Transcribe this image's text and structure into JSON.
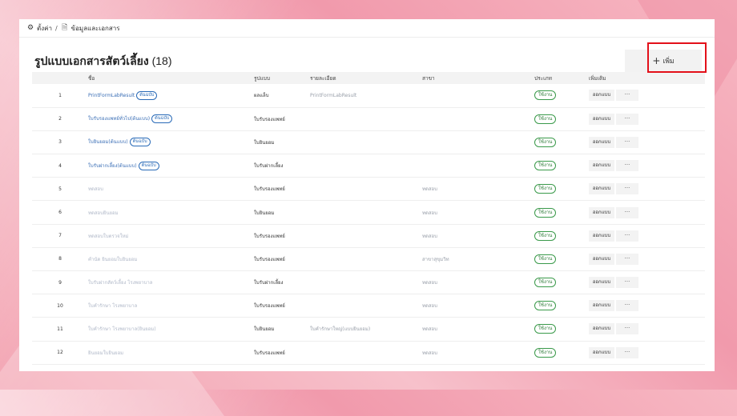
{
  "breadcrumb": {
    "settings": "ตั้งค่า",
    "separator": "/",
    "current": "ข้อมูลและเอกสาร"
  },
  "page": {
    "title": "รูปแบบเอกสารสัตว์เลี้ยง",
    "count": "(18)"
  },
  "toolbar": {
    "add_label": "เพิ่ม"
  },
  "table": {
    "headers": {
      "name": "ชื่อ",
      "format": "รูปแบบ",
      "detail": "รายละเอียด",
      "branch": "สาขา",
      "type": "ประเภท",
      "extra": "เพิ่มเติม"
    },
    "default_badge": "ต้นฉบับ",
    "export_label": "ออกแบบ",
    "more_label": "···",
    "rows": [
      {
        "no": "1",
        "name": "PrintFormLabResult",
        "default": true,
        "format": "ผลแล็บ",
        "detail": "PrintFormLabResult",
        "branch": "",
        "status": "ใช้งาน"
      },
      {
        "no": "2",
        "name": "ใบรับรองแพทย์ทั่วไป(ต้นแบบ)",
        "default": true,
        "format": "ใบรับรองแพทย์",
        "detail": "",
        "branch": "",
        "status": "ใช้งาน"
      },
      {
        "no": "3",
        "name": "ใบยินยอม(ต้นแบบ)",
        "default": true,
        "format": "ใบยินยอม",
        "detail": "",
        "branch": "",
        "status": "ใช้งาน"
      },
      {
        "no": "4",
        "name": "ใบรับฝากเลี้ยง(ต้นแบบ)",
        "default": true,
        "format": "ใบรับฝากเลี้ยง",
        "detail": "",
        "branch": "",
        "status": "ใช้งาน"
      },
      {
        "no": "5",
        "name": "ทดสอบ",
        "default": false,
        "format": "ใบรับรองแพทย์",
        "detail": "",
        "branch": "ทดสอบ",
        "status": "ใช้งาน"
      },
      {
        "no": "6",
        "name": "ทดสอบยินยอม",
        "default": false,
        "format": "ใบยินยอม",
        "detail": "",
        "branch": "ทดสอบ",
        "status": "ใช้งาน"
      },
      {
        "no": "7",
        "name": "ทดสอบใบตรวจใหม่",
        "default": false,
        "format": "ใบรับรองแพทย์",
        "detail": "",
        "branch": "ทดสอบ",
        "status": "ใช้งาน"
      },
      {
        "no": "8",
        "name": "คำนัด ยินยอมใบยินยอม",
        "default": false,
        "format": "ใบรับรองแพทย์",
        "detail": "",
        "branch": "สาขาสุขุมวิท",
        "status": "ใช้งาน"
      },
      {
        "no": "9",
        "name": "ใบรับฝากสัตว์เลี้ยง โรงพยาบาล",
        "default": false,
        "format": "ใบรับฝากเลี้ยง",
        "detail": "",
        "branch": "ทดสอบ",
        "status": "ใช้งาน"
      },
      {
        "no": "10",
        "name": "ใบคำรักษา โรงพยาบาล",
        "default": false,
        "format": "ใบรับรองแพทย์",
        "detail": "",
        "branch": "ทดสอบ",
        "status": "ใช้งาน"
      },
      {
        "no": "11",
        "name": "ใบคำรักษา โรงพยาบาล(ยินยอม)",
        "default": false,
        "format": "ใบยินยอม",
        "detail": "ใบคำรักษาใหญ่(แบบยินยอม)",
        "branch": "ทดสอบ",
        "status": "ใช้งาน"
      },
      {
        "no": "12",
        "name": "ยินยอมใบยินยอม",
        "default": false,
        "format": "ใบรับรองแพทย์",
        "detail": "",
        "branch": "ทดสอบ",
        "status": "ใช้งาน"
      }
    ]
  },
  "colors": {
    "accent": "#3b6fb6",
    "status_green": "#2b7a36",
    "highlight_red": "#e3101a"
  },
  "icons": {
    "settings": "gear-icon",
    "document": "document-icon",
    "add": "plus-icon"
  }
}
